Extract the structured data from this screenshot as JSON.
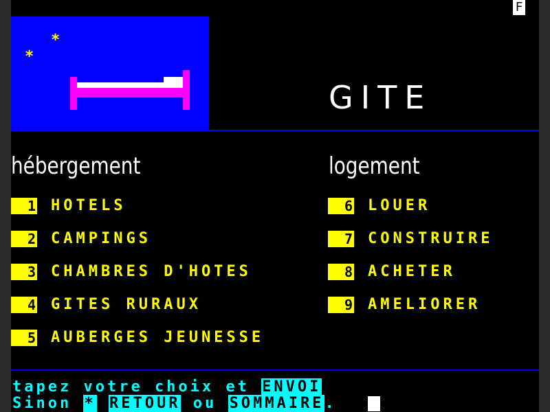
{
  "top_indicator": "F",
  "scene": {
    "stars": [
      "*",
      "*"
    ]
  },
  "title": "GITE",
  "columns": {
    "left": {
      "heading": "hébergement",
      "items": [
        {
          "num": "1",
          "label": "HOTELS"
        },
        {
          "num": "2",
          "label": "CAMPINGS"
        },
        {
          "num": "3",
          "label": "CHAMBRES D'HOTES"
        },
        {
          "num": "4",
          "label": "GITES RURAUX"
        },
        {
          "num": "5",
          "label": "AUBERGES JEUNESSE"
        }
      ]
    },
    "right": {
      "heading": "logement",
      "items": [
        {
          "num": "6",
          "label": "LOUER"
        },
        {
          "num": "7",
          "label": "CONSTRUIRE"
        },
        {
          "num": "8",
          "label": "ACHETER"
        },
        {
          "num": "9",
          "label": "AMELIORER"
        }
      ]
    }
  },
  "footer": {
    "line1_text": "tapez votre choix et",
    "envoi_key": "ENVOI",
    "line2_text": "Sinon",
    "star_key": "*",
    "retour_key": "RETOUR",
    "or_text": "ou",
    "sommaire_key": "SOMMAIRE",
    "end_mark": "."
  },
  "colors": {
    "background": "#000000",
    "accent_blue": "#0000ff",
    "menu_yellow": "#ffff00",
    "prompt_cyan": "#00ffff",
    "bed_magenta": "#ff00ff"
  }
}
